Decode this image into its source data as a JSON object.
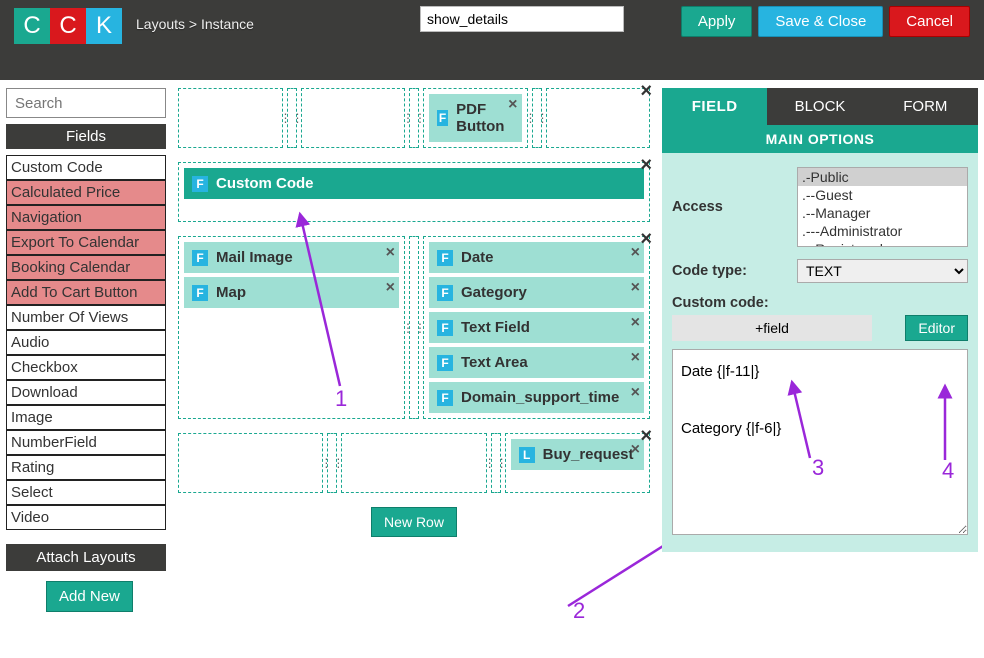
{
  "breadcrumb": "Layouts > Instance",
  "title_value": "show_details",
  "actions": {
    "apply": "Apply",
    "save": "Save & Close",
    "cancel": "Cancel"
  },
  "search_placeholder": "Search",
  "fields_header": "Fields",
  "fields": [
    {
      "label": "Custom Code",
      "hl": false
    },
    {
      "label": "Calculated Price",
      "hl": true
    },
    {
      "label": "Navigation",
      "hl": true
    },
    {
      "label": "Export To Calendar",
      "hl": true
    },
    {
      "label": "Booking Calendar",
      "hl": true
    },
    {
      "label": "Add To Cart Button",
      "hl": true
    },
    {
      "label": "Number Of Views",
      "hl": false
    },
    {
      "label": "Audio",
      "hl": false
    },
    {
      "label": "Checkbox",
      "hl": false
    },
    {
      "label": "Download",
      "hl": false
    },
    {
      "label": "Image",
      "hl": false
    },
    {
      "label": "NumberField",
      "hl": false
    },
    {
      "label": "Rating",
      "hl": false
    },
    {
      "label": "Select",
      "hl": false
    },
    {
      "label": "Video",
      "hl": false
    }
  ],
  "attach_layouts": "Attach Layouts",
  "add_new": "Add New",
  "canvas": {
    "row1_pdf": "PDF Button",
    "row2_custom": "Custom Code",
    "row3_left": [
      "Mail Image",
      "Map"
    ],
    "row3_right": [
      "Date",
      "Gategory",
      "Text Field",
      "Text Area",
      "Domain_support_time"
    ],
    "row4_buy": "Buy_request",
    "new_row": "New Row"
  },
  "right": {
    "tabs": {
      "field": "FIELD",
      "block": "BLOCK",
      "form": "FORM"
    },
    "main_options": "MAIN OPTIONS",
    "access_label": "Access",
    "access_items": [
      ".-Public",
      ".--Guest",
      ".--Manager",
      ".---Administrator",
      ".--Registered"
    ],
    "code_type_label": "Code type:",
    "code_type_value": "TEXT",
    "custom_code_label": "Custom code:",
    "plusfield": "+field",
    "editor": "Editor",
    "code_value": "Date {|f-11|}\n\nCategory {|f-6|}"
  },
  "annotations": {
    "n1": "1",
    "n2": "2",
    "n3": "3",
    "n4": "4"
  }
}
